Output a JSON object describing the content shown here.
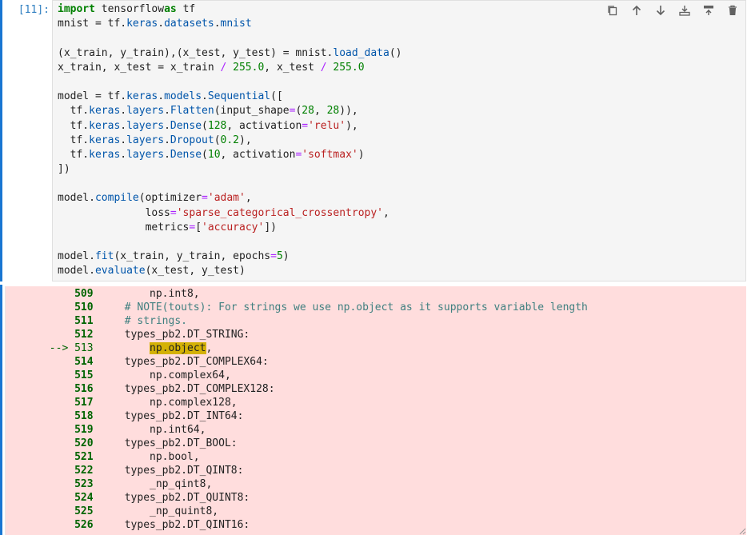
{
  "cell": {
    "prompt": "[11]:",
    "code_lines": [
      [
        [
          "kw",
          "import"
        ],
        [
          "",
          "tensorflow"
        ],
        [
          "kw",
          "as"
        ],
        [
          "",
          "tf"
        ]
      ],
      [
        [
          "",
          "mnist = tf."
        ],
        [
          "attr",
          "keras"
        ],
        [
          "",
          "."
        ],
        [
          "attr",
          "datasets"
        ],
        [
          "",
          "."
        ],
        [
          "attr",
          "mnist"
        ]
      ],
      [],
      [
        [
          "",
          "(x_train, y_train),(x_test, y_test) = mnist."
        ],
        [
          "attr",
          "load_data"
        ],
        [
          "",
          "()"
        ]
      ],
      [
        [
          "",
          "x_train, x_test = x_train "
        ],
        [
          "op",
          "/"
        ],
        [
          "",
          ""
        ],
        [
          "num",
          "255.0"
        ],
        [
          "",
          ", x_test "
        ],
        [
          "op",
          "/"
        ],
        [
          "",
          ""
        ],
        [
          "num",
          "255.0"
        ]
      ],
      [],
      [
        [
          "",
          "model = tf."
        ],
        [
          "attr",
          "keras"
        ],
        [
          "",
          "."
        ],
        [
          "attr",
          "models"
        ],
        [
          "",
          "."
        ],
        [
          "attr",
          "Sequential"
        ],
        [
          "",
          "(["
        ]
      ],
      [
        [
          "",
          "  tf."
        ],
        [
          "attr",
          "keras"
        ],
        [
          "",
          "."
        ],
        [
          "attr",
          "layers"
        ],
        [
          "",
          "."
        ],
        [
          "attr",
          "Flatten"
        ],
        [
          "",
          "(input_shape"
        ],
        [
          "op",
          "="
        ],
        [
          "",
          "("
        ],
        [
          "num",
          "28"
        ],
        [
          "",
          ", "
        ],
        [
          "num",
          "28"
        ],
        [
          "",
          ")),"
        ]
      ],
      [
        [
          "",
          "  tf."
        ],
        [
          "attr",
          "keras"
        ],
        [
          "",
          "."
        ],
        [
          "attr",
          "layers"
        ],
        [
          "",
          "."
        ],
        [
          "attr",
          "Dense"
        ],
        [
          "",
          "("
        ],
        [
          "num",
          "128"
        ],
        [
          "",
          ", activation"
        ],
        [
          "op",
          "="
        ],
        [
          "str",
          "'relu'"
        ],
        [
          "",
          "),"
        ]
      ],
      [
        [
          "",
          "  tf."
        ],
        [
          "attr",
          "keras"
        ],
        [
          "",
          "."
        ],
        [
          "attr",
          "layers"
        ],
        [
          "",
          "."
        ],
        [
          "attr",
          "Dropout"
        ],
        [
          "",
          "("
        ],
        [
          "num",
          "0.2"
        ],
        [
          "",
          "),"
        ]
      ],
      [
        [
          "",
          "  tf."
        ],
        [
          "attr",
          "keras"
        ],
        [
          "",
          "."
        ],
        [
          "attr",
          "layers"
        ],
        [
          "",
          "."
        ],
        [
          "attr",
          "Dense"
        ],
        [
          "",
          "("
        ],
        [
          "num",
          "10"
        ],
        [
          "",
          ", activation"
        ],
        [
          "op",
          "="
        ],
        [
          "str",
          "'softmax'"
        ],
        [
          "",
          ")"
        ]
      ],
      [
        [
          "",
          "])"
        ]
      ],
      [],
      [
        [
          "",
          "model."
        ],
        [
          "attr",
          "compile"
        ],
        [
          "",
          "(optimizer"
        ],
        [
          "op",
          "="
        ],
        [
          "str",
          "'adam'"
        ],
        [
          "",
          ","
        ]
      ],
      [
        [
          "",
          "              loss"
        ],
        [
          "op",
          "="
        ],
        [
          "str",
          "'sparse_categorical_crossentropy'"
        ],
        [
          "",
          ","
        ]
      ],
      [
        [
          "",
          "              metrics"
        ],
        [
          "op",
          "="
        ],
        [
          "",
          "["
        ],
        [
          "str",
          "'accuracy'"
        ],
        [
          "",
          "])"
        ]
      ],
      [],
      [
        [
          "",
          "model."
        ],
        [
          "attr",
          "fit"
        ],
        [
          "",
          "(x_train, y_train, epochs"
        ],
        [
          "op",
          "="
        ],
        [
          "num",
          "5"
        ],
        [
          "",
          ")"
        ]
      ],
      [
        [
          "",
          "model."
        ],
        [
          "attr",
          "evaluate"
        ],
        [
          "",
          "(x_test, y_test)"
        ]
      ]
    ]
  },
  "toolbar": {
    "icons": [
      "duplicate-icon",
      "move-up-icon",
      "move-down-icon",
      "insert-above-icon",
      "insert-below-icon",
      "delete-icon"
    ]
  },
  "traceback": {
    "arrow": "-->",
    "lines": [
      {
        "num": "509",
        "text": "        np.int8,"
      },
      {
        "num": "510",
        "text": "    # NOTE(touts): For strings we use np.object as it supports variable length",
        "comment": true
      },
      {
        "num": "511",
        "text": "    # strings.",
        "comment": true
      },
      {
        "num": "512",
        "text": "    types_pb2.DT_STRING:"
      },
      {
        "num": "513",
        "text": "        ",
        "hl": "np.object",
        "after": ",",
        "current": true
      },
      {
        "num": "514",
        "text": "    types_pb2.DT_COMPLEX64:"
      },
      {
        "num": "515",
        "text": "        np.complex64,"
      },
      {
        "num": "516",
        "text": "    types_pb2.DT_COMPLEX128:"
      },
      {
        "num": "517",
        "text": "        np.complex128,"
      },
      {
        "num": "518",
        "text": "    types_pb2.DT_INT64:"
      },
      {
        "num": "519",
        "text": "        np.int64,"
      },
      {
        "num": "520",
        "text": "    types_pb2.DT_BOOL:"
      },
      {
        "num": "521",
        "text": "        np.bool,"
      },
      {
        "num": "522",
        "text": "    types_pb2.DT_QINT8:"
      },
      {
        "num": "523",
        "text": "        _np_qint8,"
      },
      {
        "num": "524",
        "text": "    types_pb2.DT_QUINT8:"
      },
      {
        "num": "525",
        "text": "        _np_quint8,"
      },
      {
        "num": "526",
        "text": "    types_pb2.DT_QINT16:"
      }
    ]
  },
  "colors": {
    "accent": "#1976d2",
    "error_bg": "#ffdddd",
    "highlight": "#d4b106",
    "line_number": "#006400"
  }
}
